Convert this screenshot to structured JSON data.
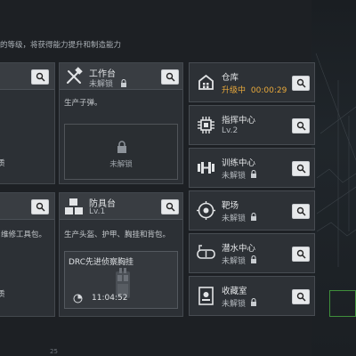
{
  "hint_text": "的等级，将获得能力提升和制造能力",
  "left_col": {
    "top_tail": "质",
    "bottom_desc": "维修工具包。",
    "bottom_tail": "质"
  },
  "workbench": {
    "title": "工作台",
    "status": "未解锁",
    "desc": "生产子弹。",
    "locked_label": "未解锁"
  },
  "armorbench": {
    "title": "防具台",
    "level": "Lv.1",
    "desc": "生产头盔、护甲、胸挂和背包。",
    "craft_name": "DRC先进侦察胸挂",
    "craft_timer": "11:04:52"
  },
  "facilities": [
    {
      "title": "仓库",
      "status_prefix": "升级中",
      "status_time": "00:00:29",
      "icon": "warehouse-icon",
      "amber": true
    },
    {
      "title": "指挥中心",
      "status": "Lv.2",
      "icon": "command-center-icon",
      "amber": false
    },
    {
      "title": "训练中心",
      "status": "未解锁",
      "icon": "dumbbell-icon",
      "amber": false
    },
    {
      "title": "靶场",
      "status": "未解锁",
      "icon": "target-icon",
      "amber": false
    },
    {
      "title": "潜水中心",
      "status": "未解锁",
      "icon": "diving-mask-icon",
      "amber": false
    },
    {
      "title": "收藏室",
      "status": "未解锁",
      "icon": "collection-icon",
      "amber": false
    }
  ],
  "bottom_number": "25",
  "colors": {
    "amber": "#e9a93b",
    "panel": "#2c3035",
    "header": "#393d42"
  }
}
